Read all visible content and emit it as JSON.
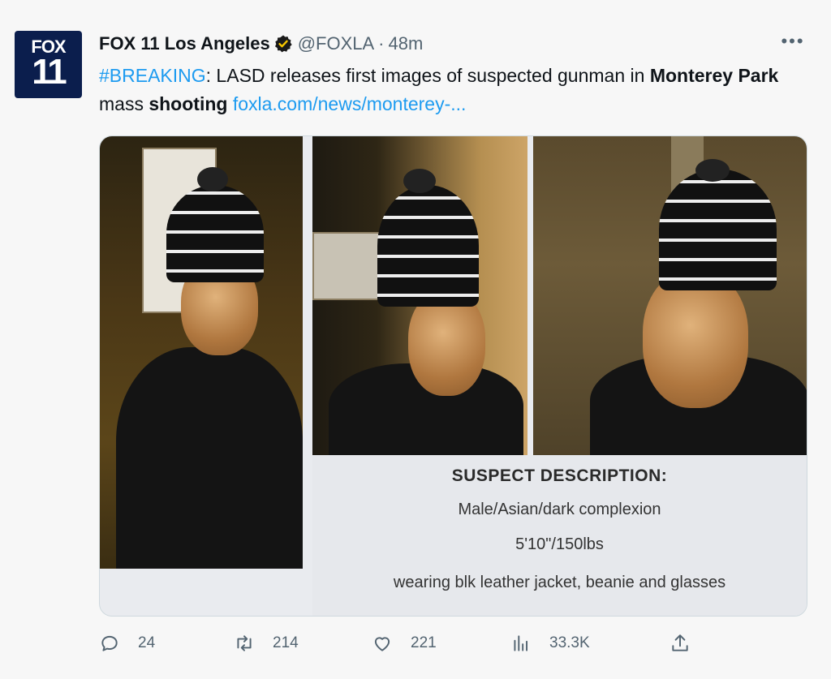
{
  "account": {
    "name": "FOX 11 Los Angeles",
    "handle": "@FOXLA",
    "separator": "·",
    "time": "48m",
    "avatar_line1": "FOX",
    "avatar_line2": "11",
    "verified_icon": "verified-badge-icon"
  },
  "tweet": {
    "hashtag": "#BREAKING",
    "part1": ": LASD releases first images of suspected gunman in ",
    "bold1": "Monterey Park",
    "part2": " mass ",
    "bold2": "shooting",
    "part3": " ",
    "link": "foxla.com/news/monterey-..."
  },
  "media": {
    "title": "SUSPECT DESCRIPTION:",
    "line1": "Male/Asian/dark complexion",
    "line2": "5'10\"/150lbs",
    "line3": "wearing blk leather jacket, beanie and glasses"
  },
  "actions": {
    "replies": "24",
    "retweets": "214",
    "likes": "221",
    "views": "33.3K"
  },
  "colors": {
    "link": "#1d9bf0",
    "muted": "#536471",
    "background": "#f7f7f7"
  }
}
